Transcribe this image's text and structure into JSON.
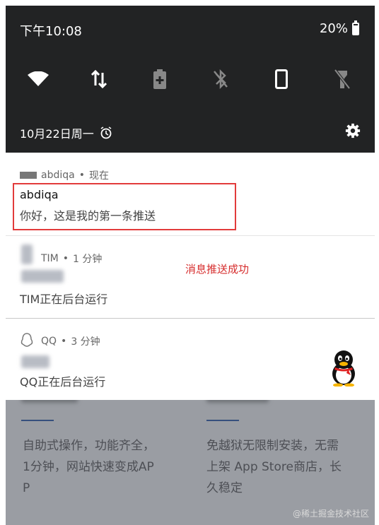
{
  "status_bar": {
    "time": "下午10:08",
    "battery": "20%"
  },
  "quick_settings": [
    "wifi-icon",
    "data-transfer-icon",
    "battery-saver-icon",
    "bluetooth-off-icon",
    "phone-icon",
    "flashlight-off-icon"
  ],
  "date_row": {
    "date": "10月22日周一"
  },
  "notifications": [
    {
      "app": "abdiqa",
      "time": "现在",
      "title": "abdiqa",
      "body": "你好，这是我的第一条推送"
    },
    {
      "app": "TIM",
      "time": "1 分钟",
      "body": "TIM正在后台运行"
    },
    {
      "app": "QQ",
      "time": "3 分钟",
      "body": "QQ正在后台运行"
    }
  ],
  "annotation": "消息推送成功",
  "background": {
    "left_text": [
      "自助式操作，功能齐全，",
      "1分钟，网站快速变成AP",
      "P"
    ],
    "right_text": [
      "免越狱无限制安装，无需",
      "上架 App Store商店，长",
      "久稳定"
    ]
  },
  "watermark": "@稀土掘金技术社区",
  "colors": {
    "shade": "#222324",
    "annotation": "#d62d2d",
    "highlight": "#e23b3b"
  }
}
